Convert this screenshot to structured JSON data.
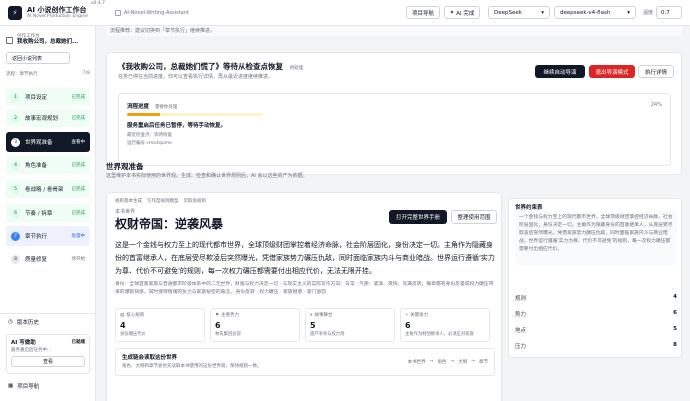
{
  "app": {
    "title": "AI 小说创作工作台",
    "subtitle": "AI Novel Production Engine",
    "version": "v0.4.7",
    "breadcrumb": "AI-Novel-Writing-Assistant",
    "logo_char": "⚡"
  },
  "toolbar": {
    "project_nav": "项目导航",
    "ai_complete": "AI 完成",
    "provider": "DeepSeek",
    "model": "deepseek-v4-flash",
    "temp_label": "温度",
    "temp_value": "0.7"
  },
  "sidebar": {
    "workspace_label": "创作工作台",
    "workspace_name": "我收购公司，总裁她们...",
    "back_button": "返回小说列表",
    "flow_label": "流程：章节执行",
    "flow_count": "7/8",
    "steps": [
      {
        "num": "1",
        "name": "项目设定",
        "status": "已完成"
      },
      {
        "num": "2",
        "name": "故事宏观规划",
        "status": "已完成"
      },
      {
        "num": "3",
        "name": "世界观准备",
        "status": "查看中"
      },
      {
        "num": "4",
        "name": "角色准备",
        "status": "已完成"
      },
      {
        "num": "5",
        "name": "卷战略 / 卷骨架",
        "status": "已完成"
      },
      {
        "num": "6",
        "name": "节奏 / 拆章",
        "status": "已完成"
      },
      {
        "num": "7",
        "name": "章节执行",
        "status": "处理中"
      },
      {
        "num": "8",
        "name": "质量修复",
        "status": "待开始"
      }
    ],
    "history": "版本历史",
    "ai_card": {
      "title": "AI 写做助",
      "status": "已就绪",
      "sub": "服务重启后任务中...",
      "view": "查看"
    },
    "nav": "项目导航"
  },
  "main": {
    "hint": "流程推荐：建议切换到「章节执行」继续推进。",
    "recovery": {
      "title": "《我收购公司，总裁她们慌了》等待从检查点恢复",
      "tag": "待处理",
      "sub": "任务已停在当前进度。你可以查看执行详情，再从最近进度继续推进。",
      "resume": "继续自动导演",
      "exit": "退出导演模式",
      "details": "执行详情"
    },
    "progress": {
      "title": "流程进度",
      "state": "需要你处理",
      "percent": "24%",
      "fill": 0.24,
      "message": "服务重启后任务已暂停，等待手动恢复。",
      "checkpoint": "最近检查点：等待恢复",
      "run_id": "运行编号 cmo4qume"
    },
    "section": {
      "title": "世界观准备",
      "sub": "这里维护本书实际使用的世界观。生成、检查和确认世界规则后，AI 会以这些资产为依据。"
    },
    "world": {
      "tabs": [
        "规则基本生成",
        "写作型规则模型",
        "可取角规则"
      ],
      "label": "本书世界",
      "title": "权财帝国：逆袭风暴",
      "open_btn": "打开完整世界手册",
      "organize_btn": "整理使用范围",
      "paragraph": "这是一个金钱与权力至上的现代都市世界，全球顶级财团掌控着经济命脉，社会阶层固化，身份决定一切。主角作为隐藏身份的首富继承人，在底层受尽欺凌后突然曝光，凭借家族势力碾压仇敌，同时面临家族内斗与商业暗战。世界运行遵循'实力为尊、代价不可避免'的规则，每一次权力碾压都需要付出相应代价，无法无限开挂。",
      "small": "身份：全球首富家族与普通都市阶级体系中的二元世界，财富与权力决定一切 · 与现实主义的实际写作方向：日常 · 气质：紧凑、爽快、充满反转，每章都有身份反差或权力碾压带来的爆裂快感，同时保持情绪的张力与家族秘密的悬念。· 身份反转 · 权力碾压 · 家族继承 · 豪门恩怨",
      "stats": [
        {
          "label": "核心规则",
          "value": "4",
          "note": "身份碾压代价"
        },
        {
          "label": "主要势力",
          "value": "6",
          "note": "林氏集团总部"
        },
        {
          "label": "故事舞台",
          "value": "5",
          "note": "遗产争夺与权力场"
        },
        {
          "label": "关键张力",
          "value": "6",
          "note": "主角作为财团继承人，必须应对家族"
        }
      ],
      "gen": {
        "title": "生成链会读取这份世界",
        "sub": "角色、大纲和章节会优先读取本书使用的这份世界观，保持规则一致。",
        "chain": [
          "本书世界",
          "→",
          "角色",
          "→",
          "大纲",
          "→",
          "章节"
        ]
      }
    },
    "summary": {
      "title": "世界约束表",
      "text": "一个金钱与权力至上的现代都市世界，全球顶级财团掌控经济命脉，社会阶层固化，身份决定一切。主角作为隐藏身份的首富继承人，从底层受尽欺凌后突然曝光，凭借家族势力碾压仇敌，同时面临家族内斗与商业暗战。世界运行遵循'实力为尊、代价不可避免'的规则，每一次权力碾压都需要付出相应代价。",
      "rows": [
        {
          "label": "规则",
          "count": "4"
        },
        {
          "label": "势力",
          "count": "6"
        },
        {
          "label": "地点",
          "count": "5"
        },
        {
          "label": "压力",
          "count": "8"
        }
      ]
    }
  },
  "colors": {
    "accent": "#111827",
    "progress": "#f59e0b",
    "danger": "#dc2626",
    "success": "#16a34a"
  }
}
